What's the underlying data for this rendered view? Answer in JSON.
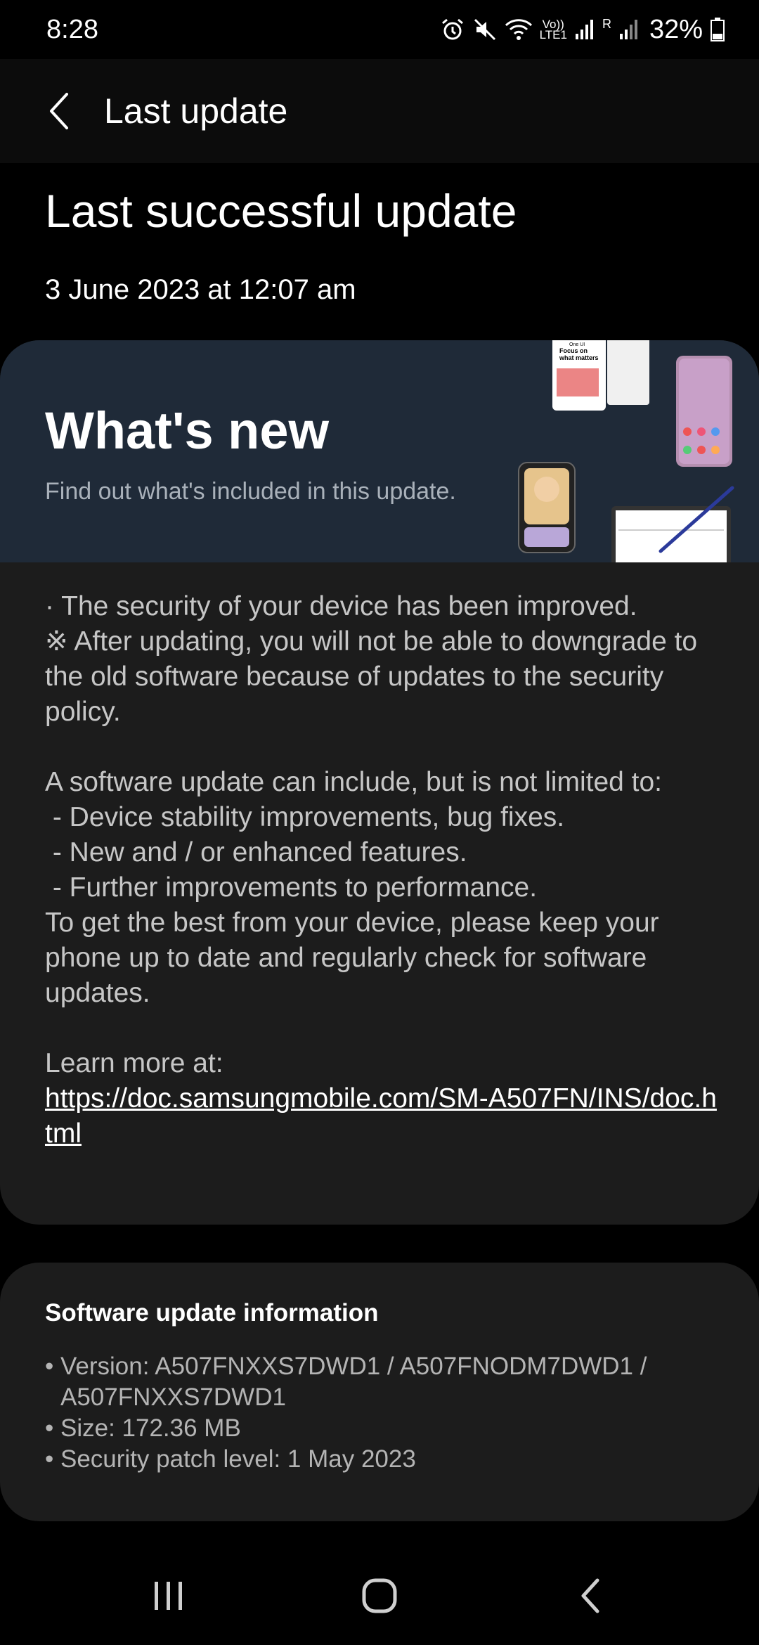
{
  "status_bar": {
    "time": "8:28",
    "volte_top": "Vo))",
    "volte_bottom": "LTE1",
    "roaming": "R",
    "battery": "32%"
  },
  "app_bar": {
    "title": "Last update"
  },
  "page": {
    "heading": "Last successful update",
    "date": "3 June 2023 at 12:07 am"
  },
  "whats_new": {
    "title": "What's new",
    "subtitle": "Find out what's included in this update.",
    "illustration_text": "One UI\nFocus on\nwhat matters",
    "paragraph_1": "· The security of your device has been improved.\n※ After updating, you will not be able to downgrade to the old software because of updates to the security policy.",
    "paragraph_2": "A software update can include, but is not limited to:\n - Device stability improvements, bug fixes.\n - New and / or enhanced features.\n - Further improvements to performance.\nTo get the best from your device, please keep your phone up to date and regularly check for software updates.",
    "learn_more_label": "Learn more at:",
    "learn_more_link": "https://doc.samsungmobile.com/SM-A507FN/INS/doc.html"
  },
  "info": {
    "title": "Software update information",
    "items": [
      "Version: A507FNXXS7DWD1 / A507FNODM7DWD1 / A507FNXXS7DWD1",
      "Size: 172.36 MB",
      "Security patch level: 1 May 2023"
    ]
  },
  "colors": {
    "background": "#000000",
    "card": "#1c1c1c",
    "banner": "#1f2a38",
    "body_text": "#c6c6c6"
  },
  "icons": [
    "back-arrow-icon",
    "alarm-icon",
    "mute-icon",
    "wifi-icon",
    "signal-icon",
    "battery-icon",
    "recents-icon",
    "home-icon",
    "nav-back-icon"
  ]
}
